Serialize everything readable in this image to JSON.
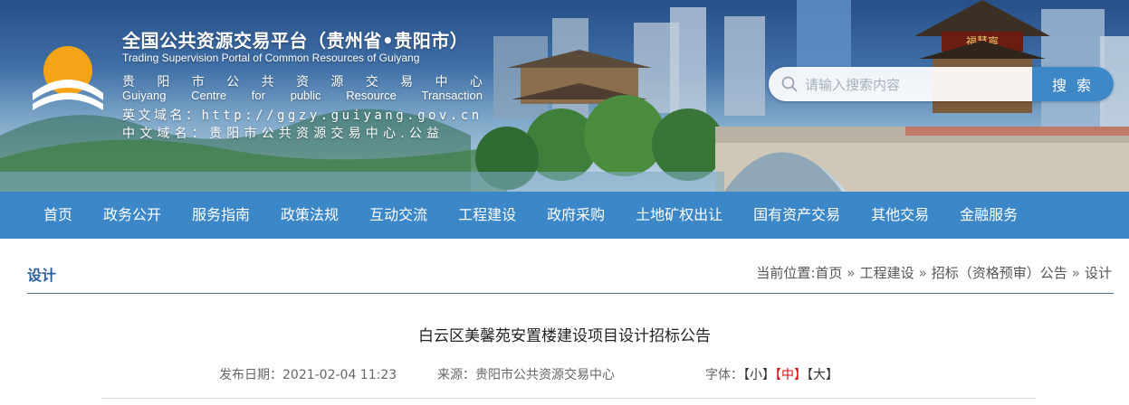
{
  "header": {
    "title": "全国公共资源交易平台（贵州省•贵阳市）",
    "title_en": "Trading Supervision Portal of Common Resources of Guiyang",
    "center_cn": [
      "贵",
      "阳",
      "市",
      "公",
      "共",
      "资",
      "源",
      "交",
      "易",
      "中",
      "心"
    ],
    "center_en": [
      "Guiyang",
      "Centre",
      "for",
      "public",
      "Resource",
      "Transaction"
    ],
    "domain_en": "英文域名：http://ggzy.guiyang.gov.cn",
    "domain_cn": "中文域名：贵阳市公共资源交易中心.公益",
    "gate_sign": "福慧寧"
  },
  "search": {
    "placeholder": "请输入搜索内容",
    "button_label": "搜 索"
  },
  "nav": {
    "items": [
      "首页",
      "政务公开",
      "服务指南",
      "政策法规",
      "互动交流",
      "工程建设",
      "政府采购",
      "土地矿权出让",
      "国有资产交易",
      "其他交易",
      "金融服务"
    ]
  },
  "section": {
    "title": "设计",
    "breadcrumb_prefix": "当前位置:",
    "breadcrumb": [
      "首页",
      "工程建设",
      "招标（资格预审）公告",
      "设计"
    ],
    "separator": "»"
  },
  "article": {
    "title": "白云区美馨苑安置楼建设项目设计招标公告",
    "date_label": "发布日期：",
    "date": "2021-02-04 11:23",
    "source_label": "来源：",
    "source": "贵阳市公共资源交易中心",
    "font_label": "字体：",
    "font_small": "【小】",
    "font_medium": "【中】",
    "font_large": "【大】"
  },
  "colors": {
    "nav_bg": "#3b87c7",
    "section_title": "#2a5d9e",
    "font_active": "#d31010",
    "search_button": "#3f88c7"
  },
  "icons": [
    "logo-icon",
    "search-icon"
  ]
}
